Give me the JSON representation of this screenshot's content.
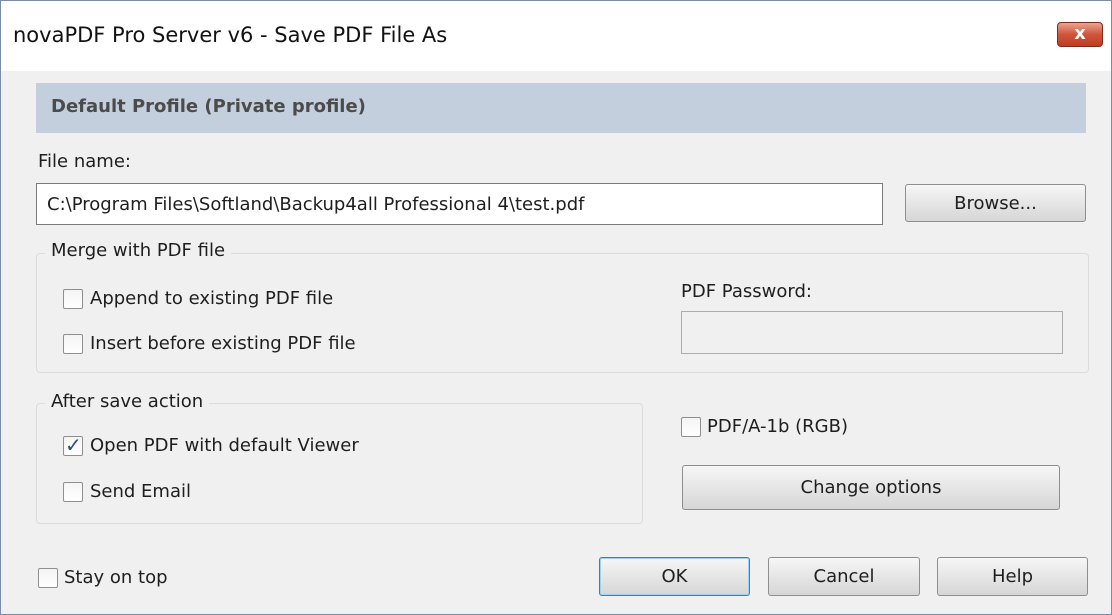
{
  "window": {
    "title": "novaPDF Pro Server v6 - Save PDF File As",
    "close_glyph": "x"
  },
  "profile": {
    "name": "Default Profile (Private profile)"
  },
  "file": {
    "label": "File name:",
    "value": "C:\\Program Files\\Softland\\Backup4all Professional 4\\test.pdf",
    "browse_label": "Browse..."
  },
  "merge": {
    "title": "Merge with PDF file",
    "append_label": "Append to existing PDF file",
    "append_checked": false,
    "insert_label": "Insert before existing PDF file",
    "insert_checked": false,
    "password_label": "PDF Password:",
    "password_value": ""
  },
  "after_save": {
    "title": "After save action",
    "open_label": "Open PDF with default Viewer",
    "open_checked": true,
    "email_label": "Send Email",
    "email_checked": false
  },
  "pdfa": {
    "label": "PDF/A-1b (RGB)",
    "checked": false,
    "change_label": "Change options"
  },
  "footer": {
    "stay_on_top_label": "Stay on top",
    "stay_on_top_checked": false,
    "ok_label": "OK",
    "cancel_label": "Cancel",
    "help_label": "Help"
  },
  "colors": {
    "banner": "#c3cfdc",
    "close_button": "#c9482f",
    "check_mark": "#2c4b7e"
  },
  "icons": {
    "close": "close-icon",
    "checkmark": "checkmark-icon"
  }
}
